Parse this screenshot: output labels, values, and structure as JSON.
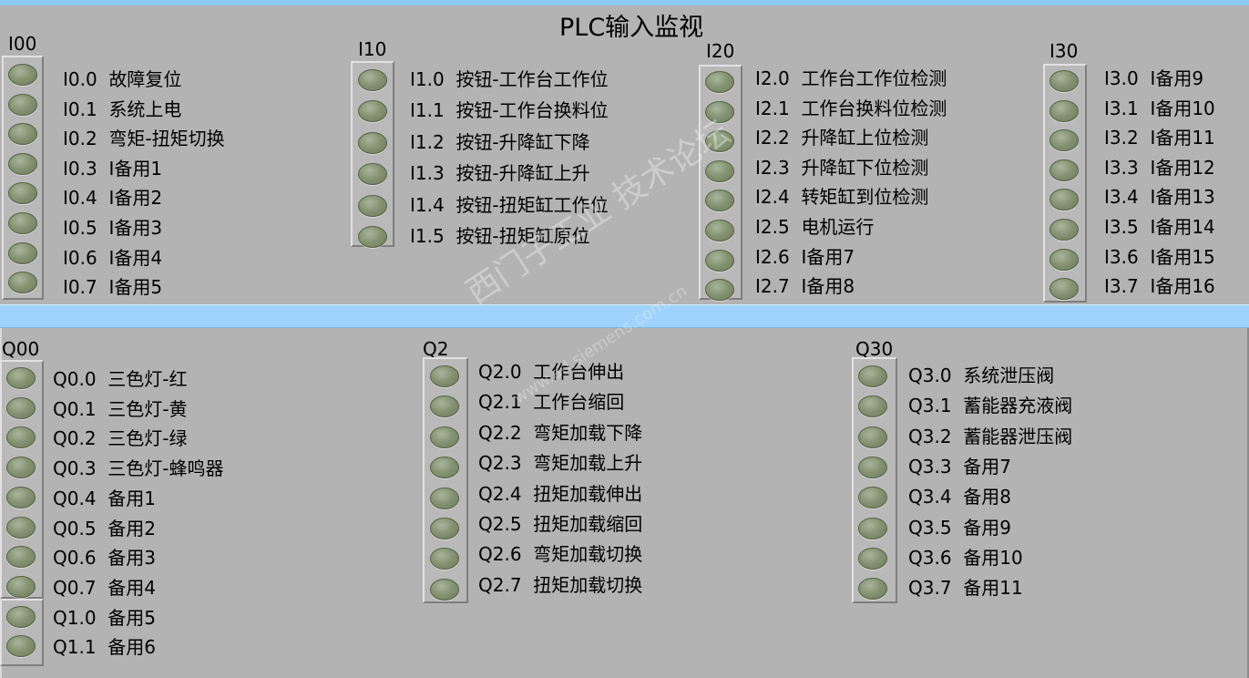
{
  "title": "PLC输入监视",
  "colors": {
    "accent_band": "#9fd3fb",
    "led_off": "#849272",
    "panel_bg": "#b3b3b3"
  },
  "input_groups": [
    {
      "label": "I00",
      "items": [
        {
          "code": "I0.0",
          "desc": "故障复位"
        },
        {
          "code": "I0.1",
          "desc": "系统上电"
        },
        {
          "code": "I0.2",
          "desc": "弯矩-扭矩切换"
        },
        {
          "code": "I0.3",
          "desc": "I备用1"
        },
        {
          "code": "I0.4",
          "desc": "I备用2"
        },
        {
          "code": "I0.5",
          "desc": "I备用3"
        },
        {
          "code": "I0.6",
          "desc": "I备用4"
        },
        {
          "code": "I0.7",
          "desc": "I备用5"
        }
      ]
    },
    {
      "label": "I10",
      "items": [
        {
          "code": "I1.0",
          "desc": "按钮-工作台工作位"
        },
        {
          "code": "I1.1",
          "desc": "按钮-工作台换料位"
        },
        {
          "code": "I1.2",
          "desc": "按钮-升降缸下降"
        },
        {
          "code": "I1.3",
          "desc": "按钮-升降缸上升"
        },
        {
          "code": "I1.4",
          "desc": "按钮-扭矩缸工作位"
        },
        {
          "code": "I1.5",
          "desc": "按钮-扭矩缸原位"
        }
      ]
    },
    {
      "label": "I20",
      "items": [
        {
          "code": "I2.0",
          "desc": "工作台工作位检测"
        },
        {
          "code": "I2.1",
          "desc": "工作台换料位检测"
        },
        {
          "code": "I2.2",
          "desc": "升降缸上位检测"
        },
        {
          "code": "I2.3",
          "desc": "升降缸下位检测"
        },
        {
          "code": "I2.4",
          "desc": "转矩缸到位检测"
        },
        {
          "code": "I2.5",
          "desc": "电机运行"
        },
        {
          "code": "I2.6",
          "desc": "I备用7"
        },
        {
          "code": "I2.7",
          "desc": "I备用8"
        }
      ]
    },
    {
      "label": "I30",
      "items": [
        {
          "code": "I3.0",
          "desc": "I备用9"
        },
        {
          "code": "I3.1",
          "desc": "I备用10"
        },
        {
          "code": "I3.2",
          "desc": "I备用11"
        },
        {
          "code": "I3.3",
          "desc": "I备用12"
        },
        {
          "code": "I3.4",
          "desc": "I备用13"
        },
        {
          "code": "I3.5",
          "desc": "I备用14"
        },
        {
          "code": "I3.6",
          "desc": "I备用15"
        },
        {
          "code": "I3.7",
          "desc": "I备用16"
        }
      ]
    }
  ],
  "output_groups": [
    {
      "label": "Q00",
      "items": [
        {
          "code": "Q0.0",
          "desc": "三色灯-红"
        },
        {
          "code": "Q0.1",
          "desc": "三色灯-黄"
        },
        {
          "code": "Q0.2",
          "desc": "三色灯-绿"
        },
        {
          "code": "Q0.3",
          "desc": "三色灯-蜂鸣器"
        },
        {
          "code": "Q0.4",
          "desc": "备用1"
        },
        {
          "code": "Q0.5",
          "desc": "备用2"
        },
        {
          "code": "Q0.6",
          "desc": "备用3"
        },
        {
          "code": "Q0.7",
          "desc": "备用4"
        },
        {
          "code": "Q1.0",
          "desc": "备用5"
        },
        {
          "code": "Q1.1",
          "desc": "备用6"
        }
      ]
    },
    {
      "label": "Q2",
      "items": [
        {
          "code": "Q2.0",
          "desc": "工作台伸出"
        },
        {
          "code": "Q2.1",
          "desc": "工作台缩回"
        },
        {
          "code": "Q2.2",
          "desc": "弯矩加载下降"
        },
        {
          "code": "Q2.3",
          "desc": "弯矩加载上升"
        },
        {
          "code": "Q2.4",
          "desc": "扭矩加载伸出"
        },
        {
          "code": "Q2.5",
          "desc": "扭矩加载缩回"
        },
        {
          "code": "Q2.6",
          "desc": "弯矩加载切换"
        },
        {
          "code": "Q2.7",
          "desc": "扭矩加载切换"
        }
      ]
    },
    {
      "label": "Q30",
      "items": [
        {
          "code": "Q3.0",
          "desc": "系统泄压阀"
        },
        {
          "code": "Q3.1",
          "desc": "蓄能器充液阀"
        },
        {
          "code": "Q3.2",
          "desc": "蓄能器泄压阀"
        },
        {
          "code": "Q3.3",
          "desc": "备用7"
        },
        {
          "code": "Q3.4",
          "desc": "备用8"
        },
        {
          "code": "Q3.5",
          "desc": "备用9"
        },
        {
          "code": "Q3.6",
          "desc": "备用10"
        },
        {
          "code": "Q3.7",
          "desc": "备用11"
        }
      ]
    }
  ],
  "watermark": {
    "main": "西门子工业 技术论坛",
    "sub": "www.ad.siemens.com.cn"
  }
}
